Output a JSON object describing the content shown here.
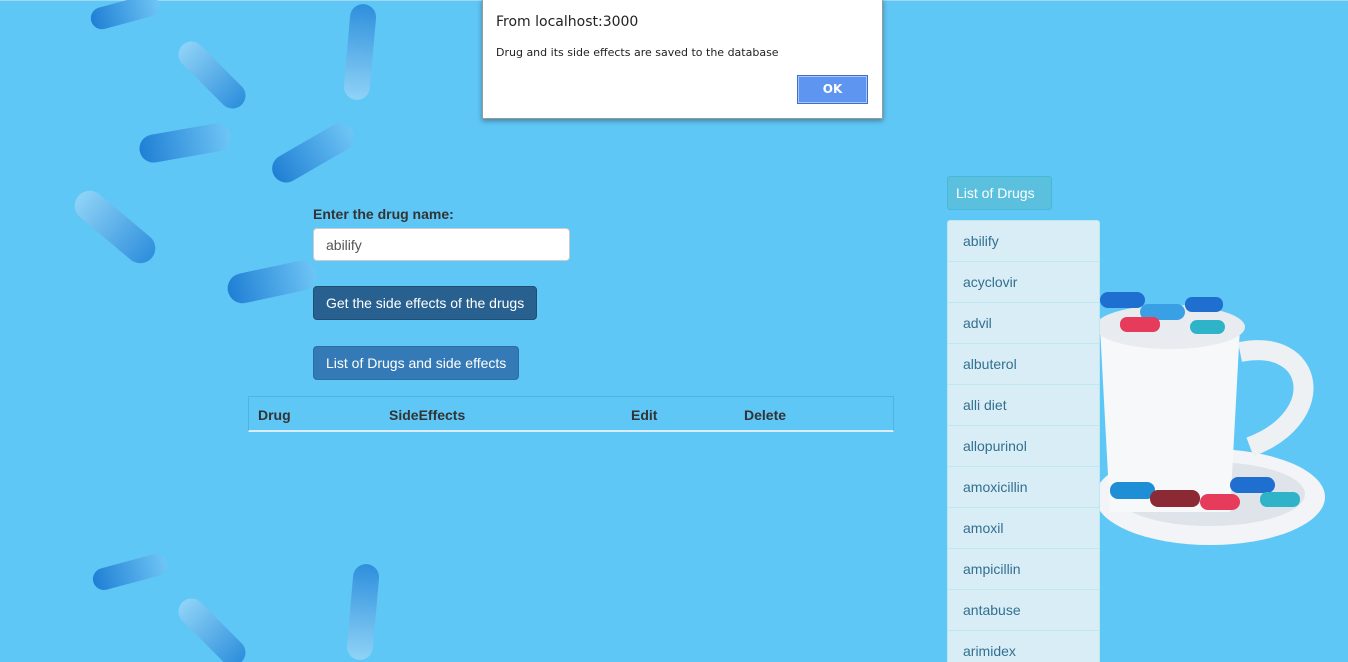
{
  "dialog": {
    "title": "From localhost:3000",
    "message": "Drug and its side effects are saved to the database",
    "ok_label": "OK"
  },
  "form": {
    "label": "Enter the drug name:",
    "input_value": "abilify",
    "get_button": "Get the side effects of the drugs",
    "list_button": "List of Drugs and side effects"
  },
  "table": {
    "headers": [
      "Drug",
      "SideEffects",
      "Edit",
      "Delete"
    ]
  },
  "sidebar": {
    "list_button": "List of Drugs",
    "drugs": [
      "abilify",
      "acyclovir",
      "advil",
      "albuterol",
      "alli diet",
      "allopurinol",
      "amoxicillin",
      "amoxil",
      "ampicillin",
      "antabuse",
      "arimidex"
    ]
  },
  "colors": {
    "background": "#5fc7f6",
    "primary_button": "#337ab7",
    "info_button": "#5bc0de",
    "list_item_bg": "#d9edf7",
    "dialog_ok": "#5e95f0"
  }
}
